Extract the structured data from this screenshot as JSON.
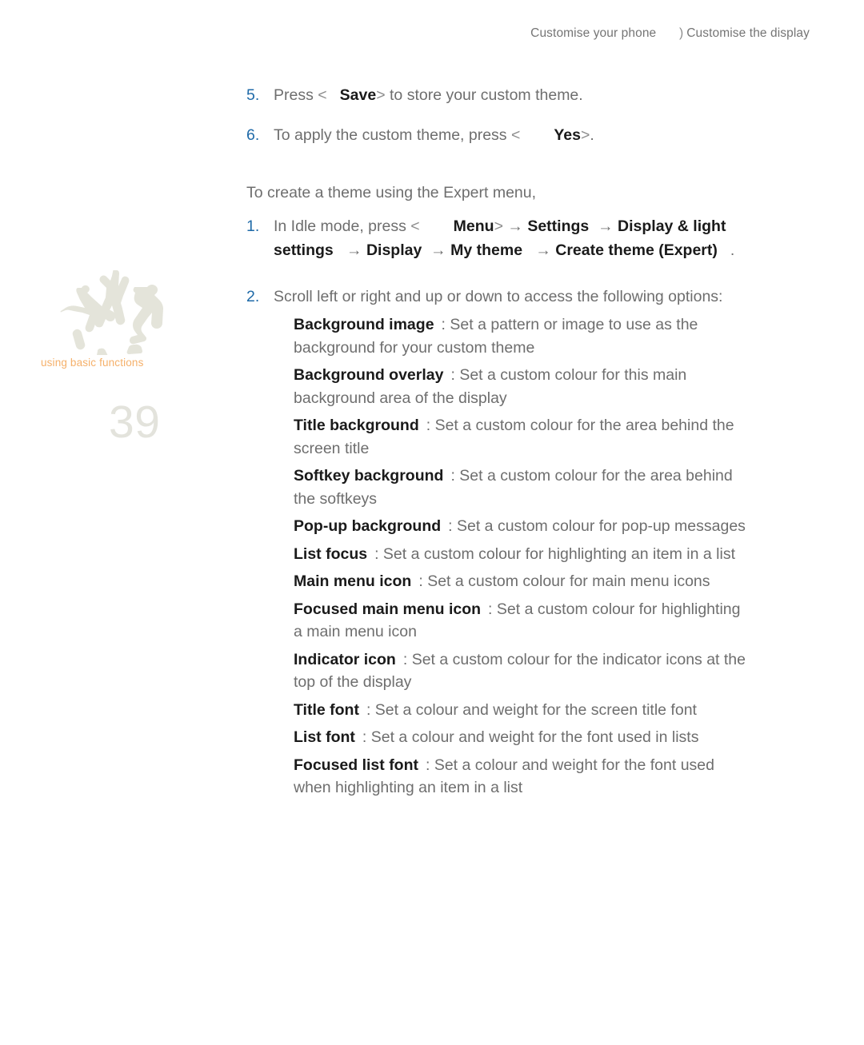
{
  "header": {
    "chapter": "Customise your phone",
    "separator": ")",
    "section": "Customise the display"
  },
  "margin": {
    "caption": "using basic functions",
    "page_number": "39",
    "decoration_icon": "breakdancers-silhouette",
    "caption_color": "#f5b06a",
    "page_number_color": "#e3e3dc",
    "decoration_color": "#e4e4da"
  },
  "colors": {
    "step_number": "#1f6aa8",
    "body_text": "#6e6e6e",
    "bold_text": "#1a1a1a",
    "header_text": "#757575"
  },
  "steps_top": [
    {
      "number": "5.",
      "parts": [
        {
          "type": "text",
          "value": "Press "
        },
        {
          "type": "light",
          "value": "<"
        },
        {
          "type": "gap_small",
          "value": ""
        },
        {
          "type": "bold",
          "value": "Save"
        },
        {
          "type": "light",
          "value": ">"
        },
        {
          "type": "text",
          "value": " to store your custom theme."
        }
      ]
    },
    {
      "number": "6.",
      "parts": [
        {
          "type": "text",
          "value": "To apply the custom theme, press "
        },
        {
          "type": "light",
          "value": "<"
        },
        {
          "type": "gap_large",
          "value": ""
        },
        {
          "type": "bold",
          "value": "Yes"
        },
        {
          "type": "light",
          "value": ">"
        },
        {
          "type": "text",
          "value": "."
        }
      ]
    }
  ],
  "lead_in": "To create a theme using the Expert menu,",
  "step_1": {
    "number": "1.",
    "intro": "In Idle mode, press ",
    "open_bracket": "<",
    "menu_label": "Menu",
    "close_bracket": ">",
    "arrow": "→",
    "path": [
      "Settings",
      "Display & light settings",
      "Display",
      "My theme",
      "Create theme (Expert)"
    ],
    "period": "."
  },
  "step_2": {
    "number": "2.",
    "text": "Scroll left or right and up or down to access the following options:"
  },
  "options": [
    {
      "term": "Background image",
      "description": ": Set a pattern or image to use as the background for your custom theme"
    },
    {
      "term": "Background overlay",
      "description": ": Set a custom colour for this main background area of the display"
    },
    {
      "term": "Title background",
      "description": ": Set a custom colour for the area behind the screen title"
    },
    {
      "term": "Softkey background",
      "description": ": Set a custom colour for the area behind the softkeys"
    },
    {
      "term": "Pop-up background",
      "description": ": Set a custom colour for pop-up messages"
    },
    {
      "term": "List focus",
      "description": ": Set a custom colour for highlighting an item in a list"
    },
    {
      "term": "Main menu icon",
      "description": ": Set a custom colour for main menu icons"
    },
    {
      "term": "Focused main menu icon",
      "description": ": Set a custom colour for highlighting a main menu icon"
    },
    {
      "term": "Indicator icon",
      "description": ": Set a custom colour for the indicator icons at the top of the display"
    },
    {
      "term": "Title font",
      "description": ": Set a colour and weight for the screen title font"
    },
    {
      "term": "List font",
      "description": ": Set a colour and weight for the font used in lists"
    },
    {
      "term": "Focused list font",
      "description": ": Set a colour and weight for the font used when highlighting an item in a list"
    }
  ]
}
